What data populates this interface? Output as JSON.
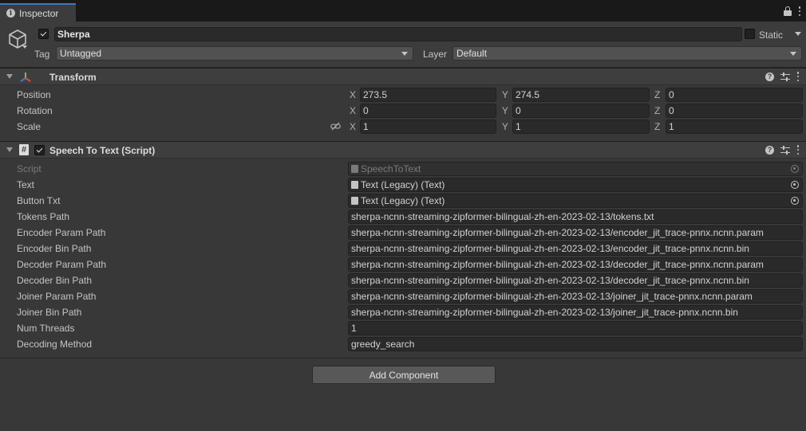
{
  "tab": {
    "title": "Inspector"
  },
  "game_object": {
    "name": "Sherpa",
    "active": true,
    "static_label": "Static",
    "static": false,
    "tag_label": "Tag",
    "tag_value": "Untagged",
    "layer_label": "Layer",
    "layer_value": "Default"
  },
  "transform": {
    "title": "Transform",
    "rows": [
      {
        "label": "Position",
        "x": "273.5",
        "y": "274.5",
        "z": "0"
      },
      {
        "label": "Rotation",
        "x": "0",
        "y": "0",
        "z": "0"
      },
      {
        "label": "Scale",
        "x": "1",
        "y": "1",
        "z": "1"
      }
    ],
    "axis": {
      "x": "X",
      "y": "Y",
      "z": "Z"
    }
  },
  "script_component": {
    "title": "Speech To Text (Script)",
    "enabled": true,
    "script_label": "Script",
    "script_value": "SpeechToText",
    "text_label": "Text",
    "text_value": "Text (Legacy) (Text)",
    "button_label": "Button Txt",
    "button_value": "Text (Legacy) (Text)",
    "fields": [
      {
        "label": "Tokens Path",
        "value": "sherpa-ncnn-streaming-zipformer-bilingual-zh-en-2023-02-13/tokens.txt"
      },
      {
        "label": "Encoder Param Path",
        "value": "sherpa-ncnn-streaming-zipformer-bilingual-zh-en-2023-02-13/encoder_jit_trace-pnnx.ncnn.param"
      },
      {
        "label": "Encoder Bin Path",
        "value": "sherpa-ncnn-streaming-zipformer-bilingual-zh-en-2023-02-13/encoder_jit_trace-pnnx.ncnn.bin"
      },
      {
        "label": "Decoder Param Path",
        "value": "sherpa-ncnn-streaming-zipformer-bilingual-zh-en-2023-02-13/decoder_jit_trace-pnnx.ncnn.param"
      },
      {
        "label": "Decoder Bin Path",
        "value": "sherpa-ncnn-streaming-zipformer-bilingual-zh-en-2023-02-13/decoder_jit_trace-pnnx.ncnn.bin"
      },
      {
        "label": "Joiner Param Path",
        "value": "sherpa-ncnn-streaming-zipformer-bilingual-zh-en-2023-02-13/joiner_jit_trace-pnnx.ncnn.param"
      },
      {
        "label": "Joiner Bin Path",
        "value": "sherpa-ncnn-streaming-zipformer-bilingual-zh-en-2023-02-13/joiner_jit_trace-pnnx.ncnn.bin"
      },
      {
        "label": "Num Threads",
        "value": "1"
      },
      {
        "label": "Decoding Method",
        "value": "greedy_search"
      }
    ]
  },
  "add_component": {
    "label": "Add Component"
  }
}
